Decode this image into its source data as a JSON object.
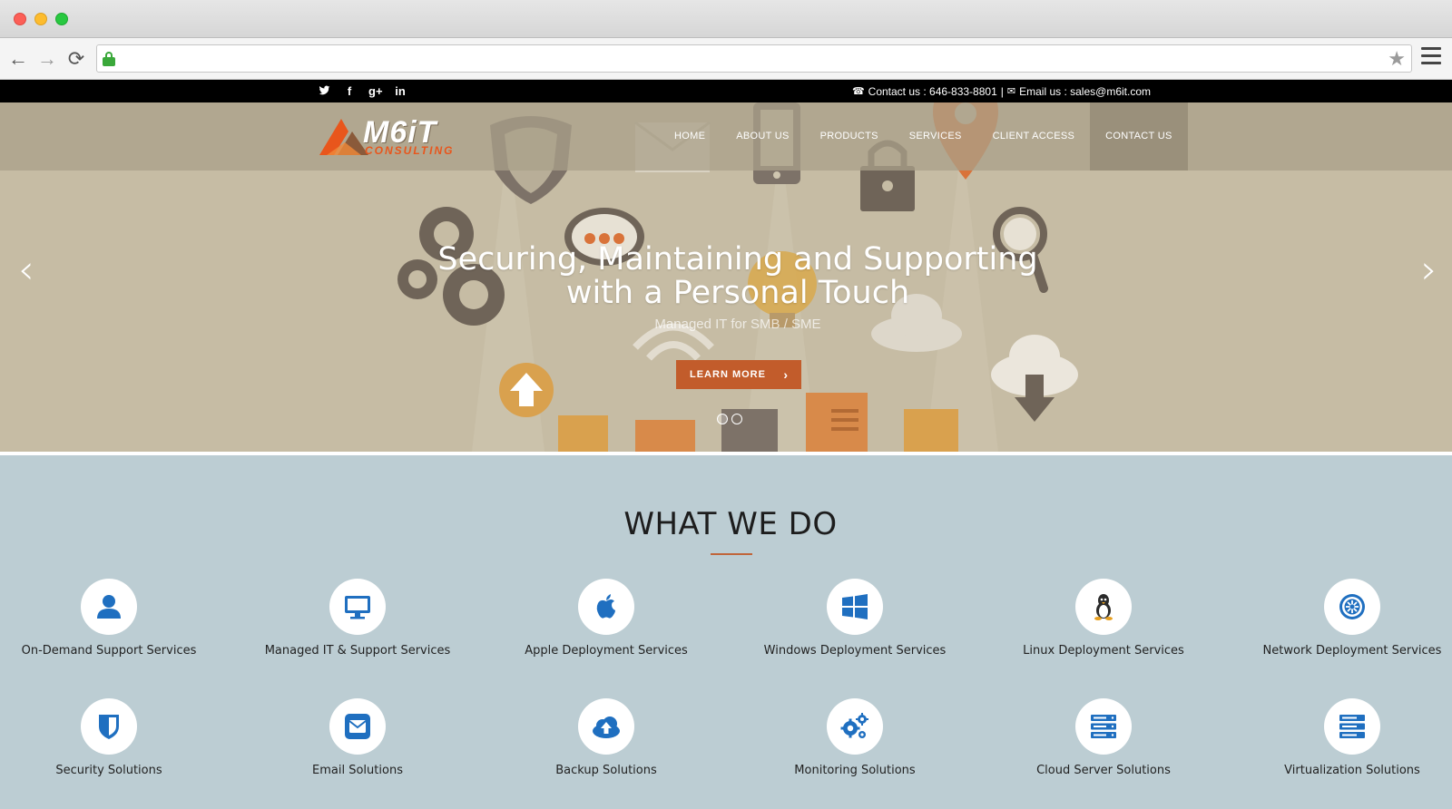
{
  "browser": {
    "url": "",
    "star_glyph": "★",
    "back_glyph": "←",
    "forward_glyph": "→",
    "reload_glyph": "⟳"
  },
  "topbar": {
    "social": [
      "twitter-icon",
      "facebook-icon",
      "google-plus-icon",
      "linkedin-icon"
    ],
    "social_glyphs": [
      "🐦",
      "f",
      "g+",
      "in"
    ],
    "contact_label": "Contact us : 646-833-8801",
    "separator": "|",
    "email_label": "Email us : sales@m6it.com"
  },
  "header": {
    "logo_text": "M6iT",
    "logo_sub": "CONSULTING",
    "nav": [
      {
        "label": "HOME"
      },
      {
        "label": "ABOUT US"
      },
      {
        "label": "PRODUCTS"
      },
      {
        "label": "SERVICES"
      },
      {
        "label": "CLIENT ACCESS"
      },
      {
        "label": "CONTACT US"
      }
    ],
    "active_nav": 5
  },
  "hero": {
    "title_line1": "Securing, Maintaining and Supporting",
    "title_line2": "with a Personal Touch",
    "subtitle": "Managed IT for SMB / SME",
    "button_label": "LEARN MORE",
    "button_glyph": "›",
    "prev_glyph": "‹",
    "next_glyph": "›",
    "slide_count": 2,
    "active_slide": 0
  },
  "services": {
    "title": "WHAT WE DO",
    "items": [
      {
        "label": "On-Demand Support Services",
        "icon": "user-icon"
      },
      {
        "label": "Managed IT & Support Services",
        "icon": "monitor-icon"
      },
      {
        "label": "Apple Deployment Services",
        "icon": "apple-icon"
      },
      {
        "label": "Windows Deployment Services",
        "icon": "windows-icon"
      },
      {
        "label": "Linux Deployment Services",
        "icon": "linux-icon"
      },
      {
        "label": "Network Deployment Services",
        "icon": "network-icon"
      },
      {
        "label": "Security Solutions",
        "icon": "shield-icon"
      },
      {
        "label": "Email Solutions",
        "icon": "email-icon"
      },
      {
        "label": "Backup Solutions",
        "icon": "cloud-upload-icon"
      },
      {
        "label": "Monitoring Solutions",
        "icon": "gears-icon"
      },
      {
        "label": "Cloud Server Solutions",
        "icon": "server-icon"
      },
      {
        "label": "Virtualization Solutions",
        "icon": "server-stack-icon"
      }
    ]
  },
  "colors": {
    "accent": "#c25c2b",
    "icon_blue": "#1f6fc0",
    "services_bg": "#bccdd3",
    "hero_bg": "#c9bfa7"
  }
}
